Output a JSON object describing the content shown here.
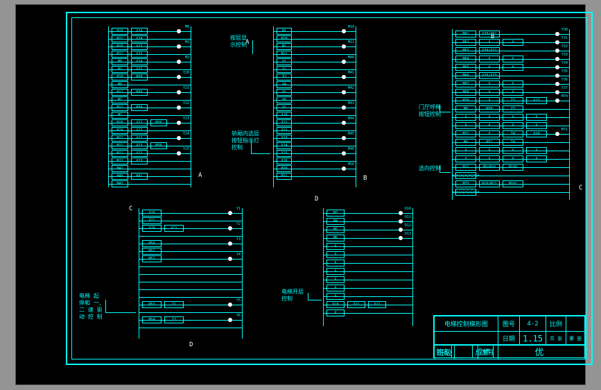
{
  "drawing": {
    "title": "电梯控制梯形图",
    "sheet_no_label": "图号",
    "sheet_no": "4-2",
    "scale_label": "比例",
    "scale": "",
    "date_label": "日期",
    "date": "1.15",
    "pages_label": "共 张",
    "page_label": "第 张",
    "class_label": "班级",
    "student_no_label": "学号",
    "name_label": "姓名",
    "grade_label": "成绩",
    "grade": "优"
  },
  "annotations": {
    "blockA_note1": "按层显\n示控制",
    "blockB_note1": "轿厢内选层\n按钮指示灯\n控制",
    "blockC_note1": "电梯 起\n停和 一、\n二 速 驱\n动 控 制",
    "blockD_note1": "电梯开层\n控制",
    "blockE_note1": "门厅呼梯\n按钮控制",
    "blockE_note2": "选向控制"
  },
  "marks": {
    "A1": "A",
    "A2": "A",
    "B1": "B",
    "B2": "B",
    "C1": "C",
    "C2": "C",
    "D1": "D",
    "D2": "D"
  },
  "ladderA": {
    "rungs": [
      {
        "in": [
          "M20",
          "X24"
        ],
        "out": "M0"
      },
      {
        "in": [
          "M21",
          "X24"
        ],
        "out": ""
      },
      {
        "in": [
          "M20",
          "X25"
        ],
        "out": "M1"
      },
      {
        "in": [
          "M22",
          "X25"
        ],
        "out": ""
      },
      {
        "in": [
          "M0",
          "X24"
        ],
        "out": "M2"
      },
      {
        "in": [
          "M1",
          "X25"
        ],
        "out": ""
      },
      {
        "in": [
          "M20",
          "M30"
        ],
        "out": "Y20"
      },
      {
        "in": [
          "M0"
        ],
        "out": ""
      },
      {
        "in": [
          "M21",
          "M30"
        ],
        "out": "Y21"
      },
      {
        "in": [
          "M1"
        ],
        "out": ""
      },
      {
        "in": [
          "M22",
          "M30"
        ],
        "out": "Y22"
      },
      {
        "in": [
          "M2"
        ],
        "out": ""
      },
      {
        "in": [
          "M20",
          "X22",
          "M30"
        ],
        "out": "Y23"
      },
      {
        "in": [
          "M20",
          "X23"
        ],
        "out": ""
      },
      {
        "in": [
          "M21",
          "X22"
        ],
        "out": "Y24"
      },
      {
        "in": [
          "M21",
          "X23",
          "M30"
        ],
        "out": ""
      },
      {
        "in": [
          "M22",
          "X22"
        ],
        "out": "Y25"
      },
      {
        "in": [
          "M22",
          "X23"
        ],
        "out": ""
      },
      {
        "in": [
          "M41"
        ],
        "out": ""
      },
      {
        "in": [
          "M40",
          "M41"
        ],
        "out": ""
      },
      {
        "in": [
          "M41"
        ],
        "out": ""
      }
    ]
  },
  "ladderB": {
    "rungs": [
      {
        "in": [
          "M1"
        ],
        "out": "M10"
      },
      {
        "in": [
          "M10"
        ],
        "out": ""
      },
      {
        "in": [
          "M2"
        ],
        "out": "M11"
      },
      {
        "in": [
          "M11"
        ],
        "out": ""
      },
      {
        "in": [
          "X1"
        ],
        "out": "M40"
      },
      {
        "in": [
          "X2"
        ],
        "out": ""
      },
      {
        "in": [
          "X3"
        ],
        "out": "M41"
      },
      {
        "in": [
          "X4"
        ],
        "out": ""
      },
      {
        "in": [
          "X5"
        ],
        "out": "M42"
      },
      {
        "in": [
          "X6"
        ],
        "out": ""
      },
      {
        "in": [
          "X7"
        ],
        "out": "M43"
      },
      {
        "in": [
          "X10"
        ],
        "out": ""
      },
      {
        "in": [
          "X11"
        ],
        "out": "M44"
      },
      {
        "in": [
          "X12"
        ],
        "out": ""
      },
      {
        "in": [
          "X13"
        ],
        "out": "M45"
      },
      {
        "in": [
          "X14"
        ],
        "out": ""
      },
      {
        "in": [
          "X15"
        ],
        "out": "M46"
      },
      {
        "in": [
          "X16"
        ],
        "out": ""
      },
      {
        "in": [
          "M20"
        ],
        "out": "M50"
      },
      {
        "in": [
          "M21"
        ],
        "out": ""
      }
    ]
  },
  "ladderC": {
    "rungs": [
      {
        "in": [
          "X20"
        ],
        "out": "Y1"
      },
      {
        "in": [
          "X21"
        ],
        "out": ""
      },
      {
        "in": [
          "X20",
          "X21"
        ],
        "out": "Y2"
      },
      {
        "in": [
          ""
        ],
        "out": ""
      },
      {
        "in": [
          "M50"
        ],
        "out": "Y3"
      },
      {
        "in": [
          "M51"
        ],
        "out": ""
      },
      {
        "in": [
          "M52"
        ],
        "out": "Y4"
      },
      {
        "in": [
          ""
        ],
        "out": ""
      },
      {
        "in": [
          ""
        ],
        "out": ""
      },
      {
        "in": [
          ""
        ],
        "out": ""
      },
      {
        "in": [
          ""
        ],
        "out": ""
      },
      {
        "in": [
          ""
        ],
        "out": ""
      },
      {
        "in": [
          "M53",
          "T1"
        ],
        "out": "Y5"
      },
      {
        "in": [
          ""
        ],
        "out": ""
      },
      {
        "in": [
          "M54",
          "T2"
        ],
        "out": "Y6"
      },
      {
        "in": [
          ""
        ],
        "out": ""
      }
    ]
  },
  "ladderD": {
    "rungs": [
      {
        "in": [
          "M3"
        ],
        "out": "D10"
      },
      {
        "in": [
          "M4"
        ],
        "out": "D11"
      },
      {
        "in": [
          "M5"
        ],
        "out": "D12"
      },
      {
        "in": [
          "M6"
        ],
        "out": "D13"
      },
      {
        "in": [
          "X"
        ],
        "out": ""
      },
      {
        "in": [
          "X"
        ],
        "out": ""
      },
      {
        "in": [
          "X"
        ],
        "out": ""
      },
      {
        "in": [
          "X"
        ],
        "out": ""
      },
      {
        "in": [
          "X"
        ],
        "out": ""
      },
      {
        "in": [
          "X"
        ],
        "out": ""
      },
      {
        "in": [
          "X"
        ],
        "out": ""
      },
      {
        "in": [
          "D20",
          "D21",
          "D22"
        ],
        "out": ""
      },
      {
        "in": [
          "X"
        ],
        "out": ""
      }
    ]
  },
  "ladderE": {
    "rungs": [
      {
        "in": [
          "M61",
          "X30/X31"
        ],
        "out": "Y30"
      },
      {
        "in": [
          "M62",
          "X",
          "X"
        ],
        "out": "Y31"
      },
      {
        "in": [
          "M63",
          "X30/X32"
        ],
        "out": "Y32"
      },
      {
        "in": [
          "M64",
          "X",
          "X"
        ],
        "out": "Y33"
      },
      {
        "in": [
          "M65",
          "X",
          "X"
        ],
        "out": "Y34"
      },
      {
        "in": [
          "M66",
          "X30/X33"
        ],
        "out": "Y35"
      },
      {
        "in": [
          "M67",
          "X",
          "X"
        ],
        "out": "Y36"
      },
      {
        "in": [
          "M68",
          "X",
          "X"
        ],
        "out": "Y37"
      },
      {
        "in": [
          "M70",
          "X",
          "T3",
          "X13"
        ],
        "out": "M70"
      },
      {
        "in": [
          "M8",
          "M30",
          "T3"
        ],
        "out": ""
      },
      {
        "in": [
          "X",
          "X",
          "X",
          "X"
        ],
        "out": ""
      },
      {
        "in": [
          "X",
          "X",
          "X",
          "X"
        ],
        "out": ""
      },
      {
        "in": [
          "M71",
          "X",
          "T4",
          "X14"
        ],
        "out": "M71"
      },
      {
        "in": [
          "M9",
          "M31",
          "T4"
        ],
        "out": ""
      },
      {
        "in": [
          "X",
          "X",
          "X",
          "X"
        ],
        "out": ""
      },
      {
        "in": [
          "X",
          "X",
          "X",
          "X"
        ],
        "out": ""
      },
      {
        "in": [
          "M72",
          "M9/M10",
          "M100"
        ],
        "out": ""
      },
      {
        "in": [
          "+[=]+[=]+[=]+"
        ],
        "out": ""
      },
      {
        "in": [
          "M73",
          "M10/M11",
          "M101"
        ],
        "out": ""
      },
      {
        "in": [
          "+[=]+[=]+[=]+"
        ],
        "out": ""
      }
    ]
  }
}
